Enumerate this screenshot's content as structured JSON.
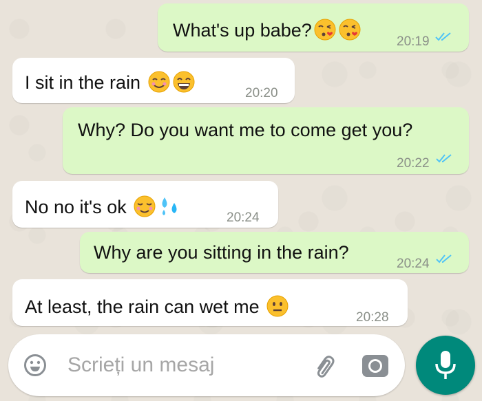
{
  "chat": {
    "messages": [
      {
        "direction": "out",
        "text": "What's up babe?",
        "emojis": [
          "face-blowing-kiss-emoji",
          "face-blowing-kiss-emoji"
        ],
        "time": "20:19",
        "status": "read"
      },
      {
        "direction": "in",
        "text": "I sit in the rain",
        "emojis": [
          "smiling-face-emoji",
          "grinning-face-emoji"
        ],
        "time": "20:20"
      },
      {
        "direction": "out",
        "text": "Why? Do you want me to come get you?",
        "time": "20:22",
        "status": "read"
      },
      {
        "direction": "in",
        "text": "No no it's ok",
        "emojis": [
          "relieved-face-emoji",
          "sweat-droplets-emoji"
        ],
        "time": "20:24"
      },
      {
        "direction": "out",
        "text": "Why are you sitting in the rain?",
        "time": "20:24",
        "status": "read"
      },
      {
        "direction": "in",
        "text": "At least, the rain can wet me",
        "emojis": [
          "neutral-face-emoji"
        ],
        "time": "20:28"
      }
    ]
  },
  "composer": {
    "placeholder": "Scrieți un mesaj",
    "emoji_icon": "smiley-icon",
    "attach_icon": "paperclip-icon",
    "camera_icon": "camera-icon",
    "mic_icon": "microphone-icon"
  },
  "colors": {
    "outgoing_bubble": "#dcf8c6",
    "incoming_bubble": "#ffffff",
    "read_ticks": "#4fc3f7",
    "accent": "#00897b",
    "background": "#e9e3da"
  }
}
